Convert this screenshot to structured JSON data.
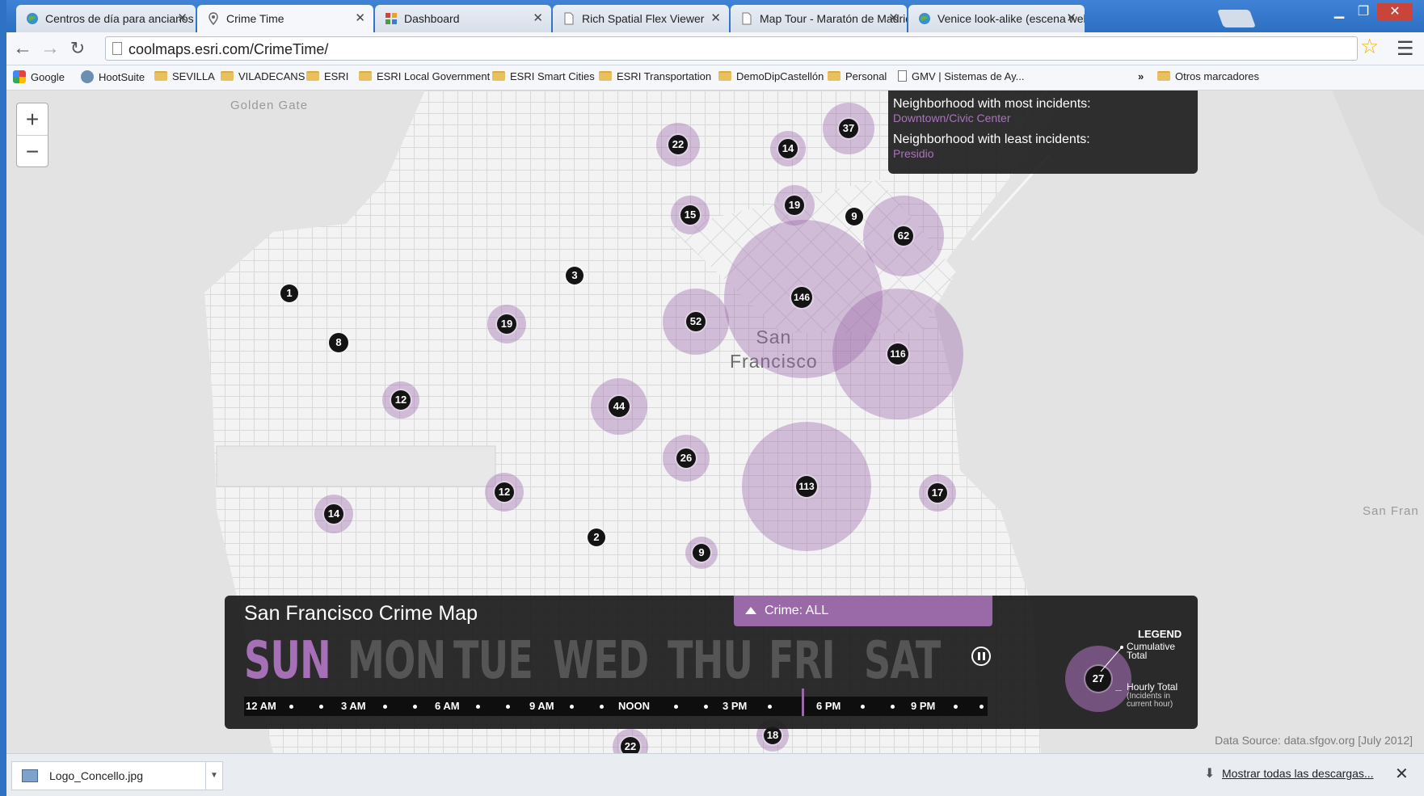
{
  "browser": {
    "tabs": [
      {
        "label": "Centros de día para ancianos"
      },
      {
        "label": "Crime Time"
      },
      {
        "label": "Dashboard"
      },
      {
        "label": "Rich Spatial Flex Viewer"
      },
      {
        "label": "Map Tour - Maratón de Madrid"
      },
      {
        "label": "Venice look-alike (escena web"
      }
    ],
    "url": "coolmaps.esri.com/CrimeTime/",
    "bookmarks": [
      "Google",
      "HootSuite",
      "SEVILLA",
      "VILADECANS",
      "ESRI",
      "ESRI Local Government",
      "ESRI Smart Cities",
      "ESRI Transportation",
      "DemoDipCastellón",
      "Personal",
      "GMV | Sistemas de Ay..."
    ],
    "bookmarks_more": "»",
    "other_bookmarks": "Otros marcadores"
  },
  "map": {
    "labels": {
      "golden_gate": "Golden Gate",
      "city_line1": "San",
      "city_line2": "Francisco",
      "edge": "San Fran"
    },
    "clusters": [
      37,
      22,
      14,
      19,
      9,
      62,
      15,
      3,
      1,
      146,
      19,
      52,
      116,
      8,
      12,
      44,
      26,
      113,
      17,
      12,
      14,
      2,
      9,
      18,
      22
    ],
    "info": {
      "most_label": "Neighborhood with most incidents:",
      "most_value": "Downtown/Civic Center",
      "least_label": "Neighborhood with least incidents:",
      "least_value": "Presidio"
    },
    "data_source": "Data Source: data.sfgov.org [July 2012]"
  },
  "panel": {
    "title": "San Francisco Crime Map",
    "crime_filter": "Crime: ALL",
    "days": [
      "SUN",
      "MON",
      "TUE",
      "WED",
      "THU",
      "FRI",
      "SAT"
    ],
    "active_day": "SUN",
    "times": [
      "12 AM",
      "3 AM",
      "6 AM",
      "9 AM",
      "NOON",
      "3 PM",
      "6 PM",
      "9 PM"
    ],
    "legend": {
      "title": "LEGEND",
      "example_value": "27",
      "cumulative_l1": "Cumulative",
      "cumulative_l2": "Total",
      "hourly_l1": "Hourly Total",
      "hourly_sub1": "(Incidents in",
      "hourly_sub2": "current hour)"
    }
  },
  "downloads": {
    "item": "Logo_Concello.jpg",
    "show_all": "Mostrar todas las descargas..."
  },
  "colors": {
    "accent": "#9a6aa8",
    "panel": "#1c1c1c",
    "chrome_blue": "#2f72c4"
  }
}
